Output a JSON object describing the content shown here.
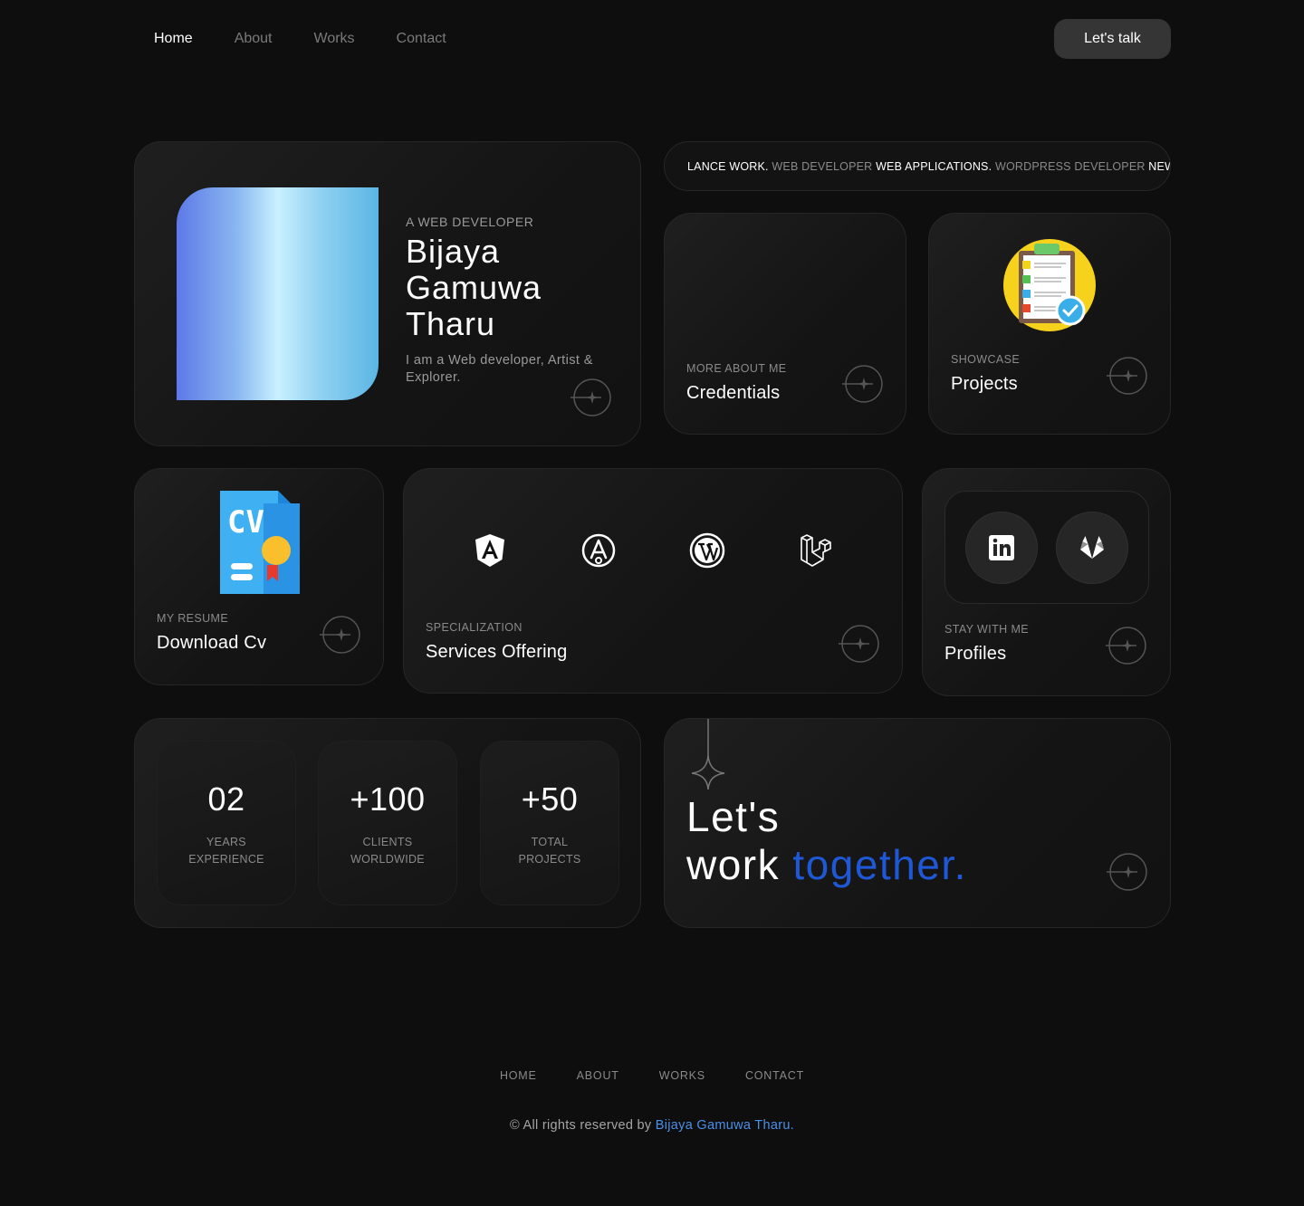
{
  "nav": {
    "links": [
      "Home",
      "About",
      "Works",
      "Contact"
    ],
    "cta": "Let's talk"
  },
  "hero": {
    "subtitle": "A WEB DEVELOPER",
    "name_line1": "Bijaya",
    "name_line2": "Gamuwa",
    "name_line3": "Tharu",
    "description": "I am a Web developer, Artist & Explorer."
  },
  "marquee": {
    "items": [
      {
        "text": "LANCE WORK.",
        "bright": true
      },
      {
        "text": "WEB DEVELOPER",
        "bright": false
      },
      {
        "text": "WEB APPLICATIONS.",
        "bright": true
      },
      {
        "text": "WORDPRESS DEVELOPER",
        "bright": false
      },
      {
        "text": "NEWS P",
        "bright": true
      }
    ]
  },
  "credentials": {
    "label": "MORE ABOUT ME",
    "title": "Credentials"
  },
  "projects": {
    "label": "SHOWCASE",
    "title": "Projects",
    "icon": "clipboard-checklist-icon"
  },
  "resume": {
    "label": "MY RESUME",
    "title": "Download Cv",
    "icon": "cv-document-icon"
  },
  "services": {
    "label": "SPECIALIZATION",
    "title": "Services Offering",
    "icons": [
      "angular-icon",
      "affinity-designer-icon",
      "wordpress-icon",
      "laravel-icon"
    ]
  },
  "profiles": {
    "label": "STAY WITH ME",
    "title": "Profiles",
    "icons": [
      "linkedin-icon",
      "gitlab-icon"
    ]
  },
  "stats": [
    {
      "value": "02",
      "label_line1": "YEARS",
      "label_line2": "EXPERIENCE"
    },
    {
      "value": "+100",
      "label_line1": "CLIENTS",
      "label_line2": "WORLDWIDE"
    },
    {
      "value": "+50",
      "label_line1": "TOTAL",
      "label_line2": "PROJECTS"
    }
  ],
  "lets_work": {
    "line1": "Let's",
    "line2_plain": "work ",
    "line2_accent": "together."
  },
  "footer": {
    "links": [
      "HOME",
      "ABOUT",
      "WORKS",
      "CONTACT"
    ],
    "copyright_prefix": "© All rights reserved by ",
    "copyright_name": "Bijaya Gamuwa Tharu."
  },
  "colors": {
    "background": "#0e0e0e",
    "accent": "#1f58d6",
    "link": "#4a8fe8"
  }
}
